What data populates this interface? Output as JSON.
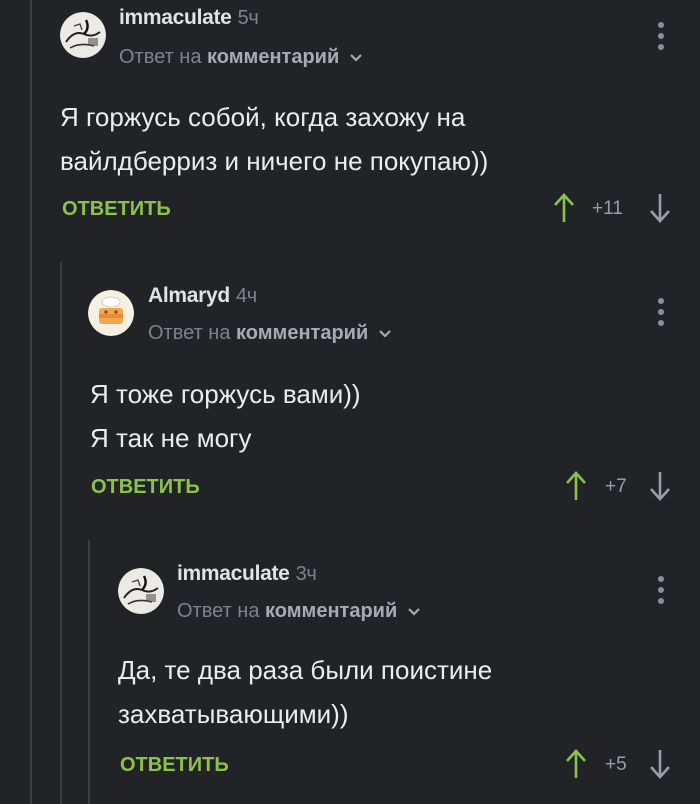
{
  "comments": [
    {
      "author": "immaculate",
      "time": "5ч",
      "reply_prefix": "Ответ на",
      "reply_target": "комментарий",
      "text_lines": [
        "Я горжусь собой, когда захожу на",
        "вайлдберриз и ничего не покупаю))"
      ],
      "reply_label": "ОТВЕТИТЬ",
      "score": "+11"
    },
    {
      "author": "Almaryd",
      "time": "4ч",
      "reply_prefix": "Ответ на",
      "reply_target": "комментарий",
      "text_lines": [
        "Я тоже горжусь вами))",
        "Я так не могу"
      ],
      "reply_label": "ОТВЕТИТЬ",
      "score": "+7"
    },
    {
      "author": "immaculate",
      "time": "3ч",
      "reply_prefix": "Ответ на",
      "reply_target": "комментарий",
      "text_lines": [
        "Да, те два раза были поистине",
        "захватывающими))"
      ],
      "reply_label": "ОТВЕТИТЬ",
      "score": "+5"
    }
  ],
  "colors": {
    "background": "#212327",
    "accent_green": "#8bc34a",
    "muted": "#7f8389"
  },
  "icons": [
    "avatar-sketch",
    "avatar-cake",
    "chevron-down-icon",
    "more-vertical-icon",
    "arrow-up-icon",
    "arrow-down-icon"
  ]
}
